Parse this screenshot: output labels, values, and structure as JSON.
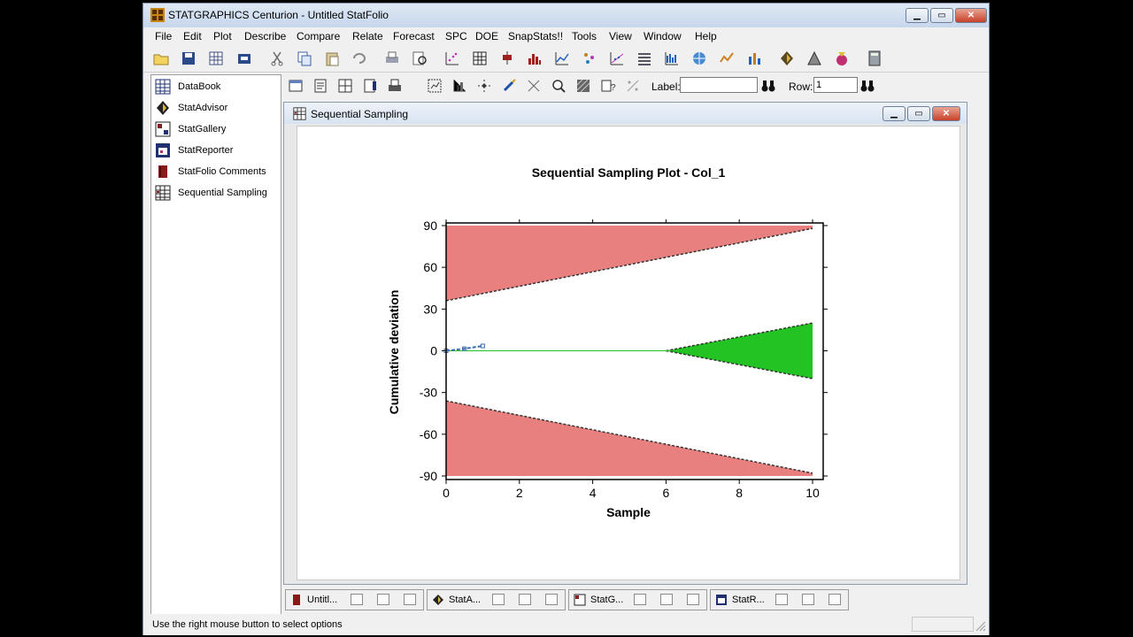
{
  "window": {
    "title": "STATGRAPHICS Centurion - Untitled StatFolio"
  },
  "menu": [
    "File",
    "Edit",
    "Plot",
    "Describe",
    "Compare",
    "Relate",
    "Forecast",
    "SPC",
    "DOE",
    "SnapStats!!",
    "Tools",
    "View",
    "Window",
    "Help"
  ],
  "sidebar": {
    "items": [
      {
        "label": "DataBook",
        "icon": "databook-icon"
      },
      {
        "label": "StatAdvisor",
        "icon": "statadvisor-icon"
      },
      {
        "label": "StatGallery",
        "icon": "statgallery-icon"
      },
      {
        "label": "StatReporter",
        "icon": "statreporter-icon"
      },
      {
        "label": "StatFolio Comments",
        "icon": "comments-icon"
      },
      {
        "label": "Sequential Sampling",
        "icon": "sequential-sampling-icon"
      }
    ]
  },
  "toolbar2": {
    "label_text": "Label:",
    "label_value": "",
    "row_text": "Row:",
    "row_value": "1"
  },
  "child_window": {
    "title": "Sequential Sampling"
  },
  "chart_data": {
    "type": "area",
    "title": "Sequential Sampling Plot - Col_1",
    "xlabel": "Sample",
    "ylabel": "Cumulative deviation",
    "xlim": [
      0,
      10
    ],
    "ylim": [
      -90,
      90
    ],
    "xticks": [
      "0",
      "2",
      "4",
      "6",
      "8",
      "10"
    ],
    "yticks": [
      "90",
      "60",
      "30",
      "0",
      "-30",
      "-60",
      "-90"
    ],
    "colors": {
      "reject": "#e88080",
      "accept": "#22c322",
      "line": "#3a6ab0",
      "center": "#22c322"
    },
    "regions": [
      {
        "name": "upper-reject",
        "boundary": [
          [
            0,
            36
          ],
          [
            10,
            88
          ]
        ],
        "to": 90
      },
      {
        "name": "lower-reject",
        "boundary": [
          [
            0,
            -36
          ],
          [
            10,
            -88
          ]
        ],
        "to": -90
      },
      {
        "name": "accept",
        "upper": [
          [
            6,
            0
          ],
          [
            10,
            20
          ]
        ],
        "lower": [
          [
            6,
            0
          ],
          [
            10,
            -20
          ]
        ]
      }
    ],
    "series": [
      {
        "x": [
          0,
          0.5,
          1
        ],
        "y": [
          0,
          1.5,
          3.5
        ]
      }
    ]
  },
  "taskbar": [
    {
      "label": "Untitl...",
      "icon": "folio-icon"
    },
    {
      "label": "StatA...",
      "icon": "statadvisor-icon"
    },
    {
      "label": "StatG...",
      "icon": "statgallery-icon"
    },
    {
      "label": "StatR...",
      "icon": "statreporter-icon"
    }
  ],
  "status": {
    "text": "Use the right mouse button to select options"
  }
}
